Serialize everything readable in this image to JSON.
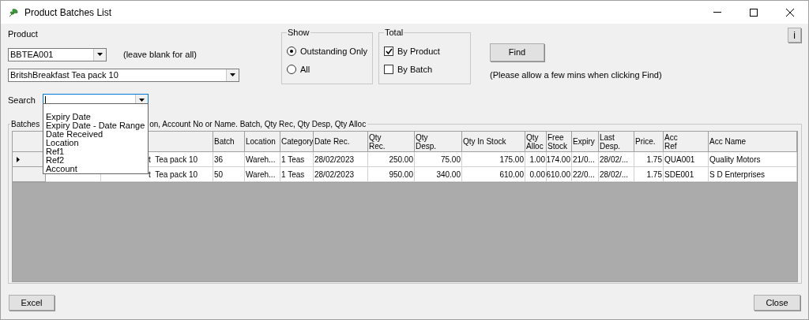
{
  "window": {
    "title": "Product Batches List"
  },
  "product": {
    "label": "Product",
    "code": "BBTEA001",
    "hint": "(leave blank for all)",
    "description": "BritshBreakfast  Tea pack 10"
  },
  "show": {
    "title": "Show",
    "options": [
      {
        "label": "Outstanding Only",
        "selected": true
      },
      {
        "label": "All",
        "selected": false
      }
    ]
  },
  "total": {
    "title": "Total",
    "options": [
      {
        "label": "By Product",
        "checked": true
      },
      {
        "label": "By Batch",
        "checked": false
      }
    ]
  },
  "find": {
    "label": "Find",
    "note": "(Please allow a few mins when clicking Find)"
  },
  "info_button": "i",
  "search": {
    "label": "Search",
    "expanded": true,
    "options": [
      "Expiry Date",
      "Expiry Date - Date Range",
      "Date Received",
      "Location",
      "Ref1",
      "Ref2",
      "Account"
    ]
  },
  "batches": {
    "title": "Batches",
    "title_rest": "on, Account No or Name. Batch, Qty Rec, Qty Desp, Qty Alloc",
    "columns": [
      "Batch",
      "Location",
      "Category",
      "Date Rec.",
      "Qty\nRec.",
      "Qty\nDesp.",
      "Qty In Stock",
      "Qty\nAlloc",
      "Free\nStock",
      "Expiry",
      "Last\nDesp.",
      "Price.",
      "Acc\nRef",
      "Acc Name"
    ],
    "rows": [
      {
        "current": true,
        "product": "t  Tea pack 10",
        "cells": [
          "36",
          "Wareh...",
          "1 Teas",
          "28/02/2023",
          "250.00",
          "75.00",
          "175.00",
          "1.00",
          "174.00",
          "21/0...",
          "28/02/...",
          "1.75",
          "QUA001",
          "Quality Motors"
        ]
      },
      {
        "current": false,
        "product": "t  Tea pack 10",
        "cells": [
          "50",
          "Wareh...",
          "1 Teas",
          "28/02/2023",
          "950.00",
          "340.00",
          "610.00",
          "0.00",
          "610.00",
          "22/0...",
          "28/02/...",
          "1.75",
          "SDE001",
          "S D Enterprises"
        ]
      }
    ]
  },
  "buttons": {
    "excel": "Excel",
    "close": "Close"
  }
}
